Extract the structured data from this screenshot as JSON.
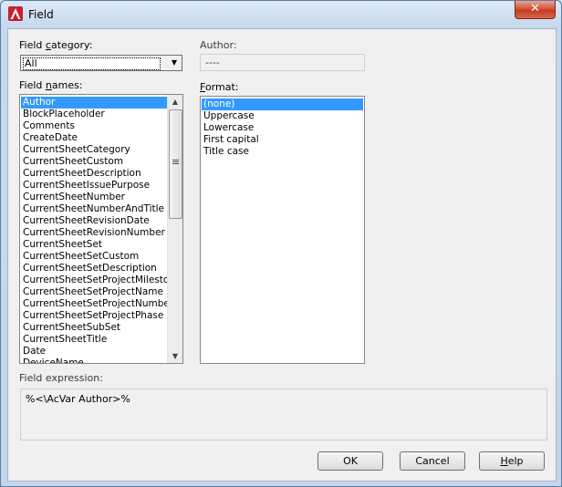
{
  "window": {
    "title": "Field",
    "close_symbol": "✕"
  },
  "field_category": {
    "label_before": "Field ",
    "mnemonic": "c",
    "label_after": "ategory:",
    "value": "All"
  },
  "author": {
    "label": "Author:",
    "value": "----"
  },
  "field_names": {
    "label_before": "Field ",
    "mnemonic": "n",
    "label_after": "ames:",
    "items": [
      "Author",
      "BlockPlaceholder",
      "Comments",
      "CreateDate",
      "CurrentSheetCategory",
      "CurrentSheetCustom",
      "CurrentSheetDescription",
      "CurrentSheetIssuePurpose",
      "CurrentSheetNumber",
      "CurrentSheetNumberAndTitle",
      "CurrentSheetRevisionDate",
      "CurrentSheetRevisionNumber",
      "CurrentSheetSet",
      "CurrentSheetSetCustom",
      "CurrentSheetSetDescription",
      "CurrentSheetSetProjectMilestone",
      "CurrentSheetSetProjectName",
      "CurrentSheetSetProjectNumber",
      "CurrentSheetSetProjectPhase",
      "CurrentSheetSubSet",
      "CurrentSheetTitle",
      "Date",
      "DeviceName"
    ],
    "selected": "Author"
  },
  "format": {
    "mnemonic": "F",
    "label_after": "ormat:",
    "items": [
      "(none)",
      "Uppercase",
      "Lowercase",
      "First capital",
      "Title case"
    ],
    "selected": "(none)"
  },
  "expression": {
    "label": "Field expression:",
    "value": "%<\\AcVar Author>%"
  },
  "buttons": {
    "ok": "OK",
    "cancel": "Cancel",
    "help_mnemonic": "H",
    "help_after": "elp"
  },
  "colors": {
    "selection": "#3399ff",
    "close_button": "#c23a1e",
    "title_bar": "#c7d9ee"
  },
  "icons": {
    "app": "autocad-logo-icon",
    "close": "close-icon"
  }
}
